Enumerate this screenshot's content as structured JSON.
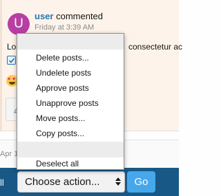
{
  "post": {
    "avatar_letter": "U",
    "author": "user",
    "verb": "commented",
    "time": "Friday at 3:39 AM",
    "text_left": "Lo",
    "text_right": "consectetur ac"
  },
  "second_post": {
    "date": "Apr 1"
  },
  "mod_bar": {
    "label": "ll",
    "select_value": "Choose action...",
    "go_label": "Go"
  },
  "menu": {
    "items": [
      "Delete posts...",
      "Undelete posts",
      "Approve posts",
      "Unapprove posts",
      "Move posts...",
      "Copy posts...",
      "Deselect all"
    ]
  },
  "colors": {
    "bar": "#185886",
    "go_button": "#47a7eb",
    "link": "#2577b1",
    "avatar": "#b73fa3",
    "post_bg": "#fdf3ea"
  }
}
